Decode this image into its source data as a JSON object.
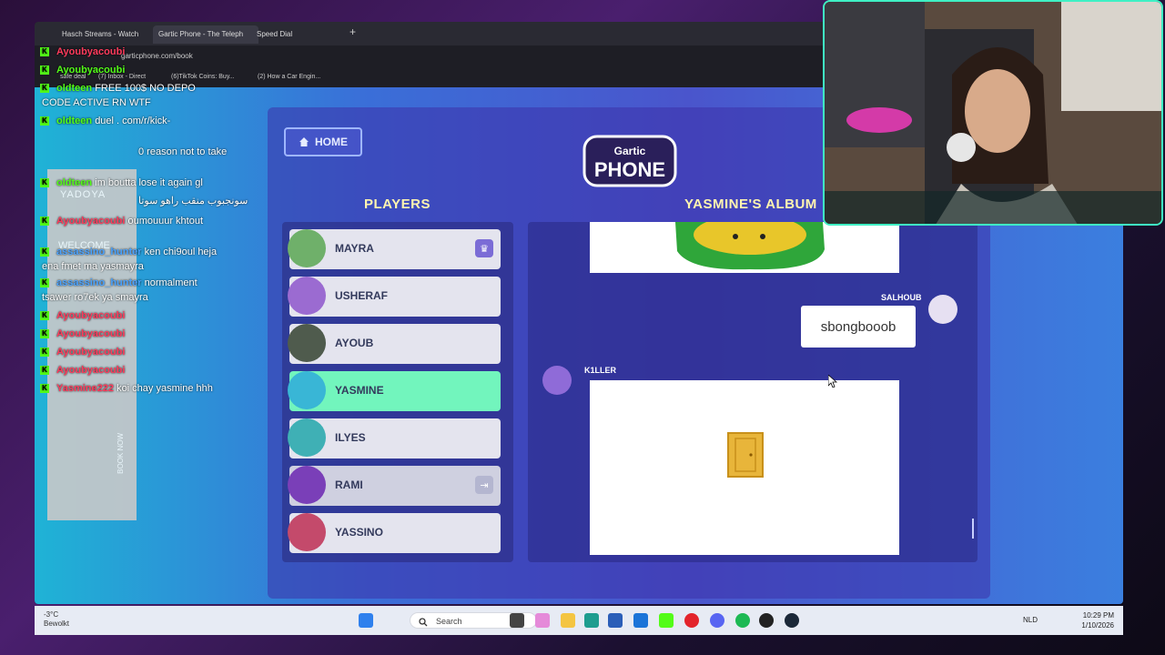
{
  "browser": {
    "tabs": [
      {
        "label": "Hasch Streams - Watch"
      },
      {
        "label": "Gartic Phone - The Teleph"
      },
      {
        "label": "Speed Dial"
      }
    ],
    "url": "garticphone.com/book",
    "bookmarks": [
      {
        "label": "safe deal"
      },
      {
        "label": "(7) Inbox - Direct"
      },
      {
        "label": "(6)TikTok Coins: Buy..."
      },
      {
        "label": "(2) How a Car Engin..."
      }
    ]
  },
  "game": {
    "home_label": "HOME",
    "logo_top": "Gartic",
    "logo_bottom": "PHONE",
    "players_title": "PLAYERS",
    "album_title": "YASMINE'S ALBUM",
    "players": [
      {
        "name": "MAYRA",
        "badge": "crown",
        "color": "#6fb06a"
      },
      {
        "name": "USHERAF",
        "badge": "",
        "color": "#9b6bd1"
      },
      {
        "name": "AYOUB",
        "badge": "",
        "color": "#4f5b4d"
      },
      {
        "name": "YASMINE",
        "badge": "",
        "color": "#39b6d6"
      },
      {
        "name": "ILYES",
        "badge": "",
        "color": "#3fb0b5"
      },
      {
        "name": "RAMI",
        "badge": "exit",
        "color": "#7a3fb8"
      },
      {
        "name": "YASSINO",
        "badge": "",
        "color": "#c44a6b"
      }
    ],
    "album": {
      "guess_author": "SALHOUB",
      "guess_text": "sbongbooob",
      "drawing_author": "K1LLER"
    }
  },
  "chat": [
    {
      "user": "Ayoubyacoubi",
      "text": "",
      "user_color": "#ff3b5c"
    },
    {
      "user": "oldteen",
      "text": "FREE 100$ NO DEPO",
      "user_color": "#53fc18"
    },
    {
      "user": "",
      "text": "CODE ACTIVE RN WTF",
      "user_color": "#53fc18"
    },
    {
      "user": "oldteen",
      "text": "duel . com/r/kick-",
      "user_color": "#53fc18"
    },
    {
      "user": "",
      "text": "0 reason not to take",
      "user_color": "#53fc18"
    },
    {
      "user": "oldteen",
      "text": "im boutta lose it again gl",
      "user_color": "#53fc18"
    },
    {
      "user": "",
      "text": "سونجبوب منقب راهو سوتا",
      "user_color": "#ff3b5c"
    },
    {
      "user": "Ayoubyacoubi",
      "text": "oumouuur khtout",
      "user_color": "#ff3b5c"
    },
    {
      "user": "assassino_hunter",
      "text": "ken chi9oul heja",
      "user_color": "#4aa3ff"
    },
    {
      "user": "",
      "text": "ena fmet ma yasmayra",
      "user_color": "#4aa3ff"
    },
    {
      "user": "assassino_hunter",
      "text": "normalment",
      "user_color": "#4aa3ff"
    },
    {
      "user": "",
      "text": "tsawer ro7ek ya smayra",
      "user_color": "#4aa3ff"
    },
    {
      "user": "Ayoubyacoubi",
      "text": "",
      "user_color": "#ff3b5c"
    },
    {
      "user": "Ayoubyacoubi",
      "text": "",
      "user_color": "#ff3b5c"
    },
    {
      "user": "Ayoubyacoubi",
      "text": "",
      "user_color": "#ff3b5c"
    },
    {
      "user": "Ayoubyacoubi",
      "text": "",
      "user_color": "#ff3b5c"
    },
    {
      "user": "Yasmine222",
      "text": "koi chay yasmine hhh",
      "user_color": "#ff3b5c"
    }
  ],
  "ad": {
    "brand": "YADOYA",
    "welcome": "WELCOME",
    "book_now": "BOOK NOW"
  },
  "taskbar": {
    "weather_temp": "-3°C",
    "weather_desc": "Bewolkt",
    "search_placeholder": "Search",
    "lang": "NLD",
    "time": "10:29 PM",
    "date": "1/10/2026"
  }
}
